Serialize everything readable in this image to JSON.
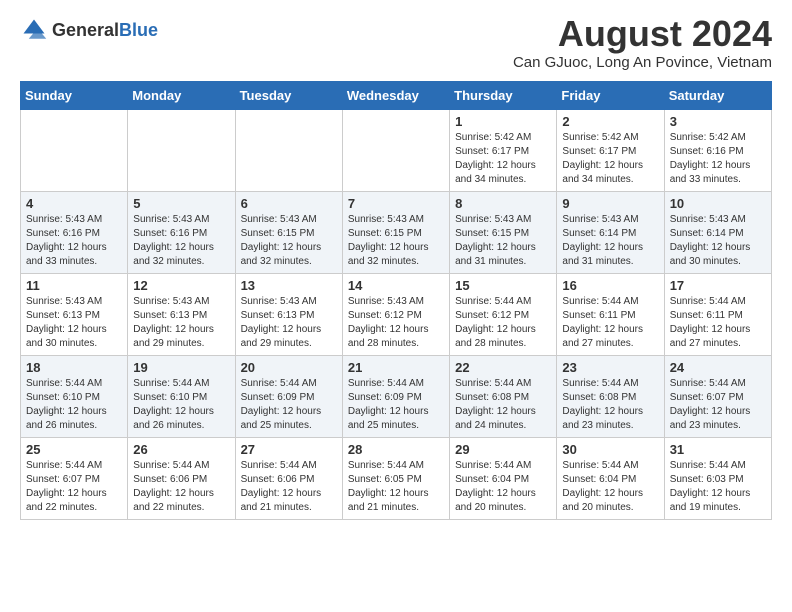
{
  "header": {
    "logo_general": "General",
    "logo_blue": "Blue",
    "month_title": "August 2024",
    "location": "Can GJuoc, Long An Povince, Vietnam"
  },
  "weekdays": [
    "Sunday",
    "Monday",
    "Tuesday",
    "Wednesday",
    "Thursday",
    "Friday",
    "Saturday"
  ],
  "weeks": [
    [
      {
        "day": "",
        "info": ""
      },
      {
        "day": "",
        "info": ""
      },
      {
        "day": "",
        "info": ""
      },
      {
        "day": "",
        "info": ""
      },
      {
        "day": "1",
        "info": "Sunrise: 5:42 AM\nSunset: 6:17 PM\nDaylight: 12 hours\nand 34 minutes."
      },
      {
        "day": "2",
        "info": "Sunrise: 5:42 AM\nSunset: 6:17 PM\nDaylight: 12 hours\nand 34 minutes."
      },
      {
        "day": "3",
        "info": "Sunrise: 5:42 AM\nSunset: 6:16 PM\nDaylight: 12 hours\nand 33 minutes."
      }
    ],
    [
      {
        "day": "4",
        "info": "Sunrise: 5:43 AM\nSunset: 6:16 PM\nDaylight: 12 hours\nand 33 minutes."
      },
      {
        "day": "5",
        "info": "Sunrise: 5:43 AM\nSunset: 6:16 PM\nDaylight: 12 hours\nand 32 minutes."
      },
      {
        "day": "6",
        "info": "Sunrise: 5:43 AM\nSunset: 6:15 PM\nDaylight: 12 hours\nand 32 minutes."
      },
      {
        "day": "7",
        "info": "Sunrise: 5:43 AM\nSunset: 6:15 PM\nDaylight: 12 hours\nand 32 minutes."
      },
      {
        "day": "8",
        "info": "Sunrise: 5:43 AM\nSunset: 6:15 PM\nDaylight: 12 hours\nand 31 minutes."
      },
      {
        "day": "9",
        "info": "Sunrise: 5:43 AM\nSunset: 6:14 PM\nDaylight: 12 hours\nand 31 minutes."
      },
      {
        "day": "10",
        "info": "Sunrise: 5:43 AM\nSunset: 6:14 PM\nDaylight: 12 hours\nand 30 minutes."
      }
    ],
    [
      {
        "day": "11",
        "info": "Sunrise: 5:43 AM\nSunset: 6:13 PM\nDaylight: 12 hours\nand 30 minutes."
      },
      {
        "day": "12",
        "info": "Sunrise: 5:43 AM\nSunset: 6:13 PM\nDaylight: 12 hours\nand 29 minutes."
      },
      {
        "day": "13",
        "info": "Sunrise: 5:43 AM\nSunset: 6:13 PM\nDaylight: 12 hours\nand 29 minutes."
      },
      {
        "day": "14",
        "info": "Sunrise: 5:43 AM\nSunset: 6:12 PM\nDaylight: 12 hours\nand 28 minutes."
      },
      {
        "day": "15",
        "info": "Sunrise: 5:44 AM\nSunset: 6:12 PM\nDaylight: 12 hours\nand 28 minutes."
      },
      {
        "day": "16",
        "info": "Sunrise: 5:44 AM\nSunset: 6:11 PM\nDaylight: 12 hours\nand 27 minutes."
      },
      {
        "day": "17",
        "info": "Sunrise: 5:44 AM\nSunset: 6:11 PM\nDaylight: 12 hours\nand 27 minutes."
      }
    ],
    [
      {
        "day": "18",
        "info": "Sunrise: 5:44 AM\nSunset: 6:10 PM\nDaylight: 12 hours\nand 26 minutes."
      },
      {
        "day": "19",
        "info": "Sunrise: 5:44 AM\nSunset: 6:10 PM\nDaylight: 12 hours\nand 26 minutes."
      },
      {
        "day": "20",
        "info": "Sunrise: 5:44 AM\nSunset: 6:09 PM\nDaylight: 12 hours\nand 25 minutes."
      },
      {
        "day": "21",
        "info": "Sunrise: 5:44 AM\nSunset: 6:09 PM\nDaylight: 12 hours\nand 25 minutes."
      },
      {
        "day": "22",
        "info": "Sunrise: 5:44 AM\nSunset: 6:08 PM\nDaylight: 12 hours\nand 24 minutes."
      },
      {
        "day": "23",
        "info": "Sunrise: 5:44 AM\nSunset: 6:08 PM\nDaylight: 12 hours\nand 23 minutes."
      },
      {
        "day": "24",
        "info": "Sunrise: 5:44 AM\nSunset: 6:07 PM\nDaylight: 12 hours\nand 23 minutes."
      }
    ],
    [
      {
        "day": "25",
        "info": "Sunrise: 5:44 AM\nSunset: 6:07 PM\nDaylight: 12 hours\nand 22 minutes."
      },
      {
        "day": "26",
        "info": "Sunrise: 5:44 AM\nSunset: 6:06 PM\nDaylight: 12 hours\nand 22 minutes."
      },
      {
        "day": "27",
        "info": "Sunrise: 5:44 AM\nSunset: 6:06 PM\nDaylight: 12 hours\nand 21 minutes."
      },
      {
        "day": "28",
        "info": "Sunrise: 5:44 AM\nSunset: 6:05 PM\nDaylight: 12 hours\nand 21 minutes."
      },
      {
        "day": "29",
        "info": "Sunrise: 5:44 AM\nSunset: 6:04 PM\nDaylight: 12 hours\nand 20 minutes."
      },
      {
        "day": "30",
        "info": "Sunrise: 5:44 AM\nSunset: 6:04 PM\nDaylight: 12 hours\nand 20 minutes."
      },
      {
        "day": "31",
        "info": "Sunrise: 5:44 AM\nSunset: 6:03 PM\nDaylight: 12 hours\nand 19 minutes."
      }
    ]
  ]
}
